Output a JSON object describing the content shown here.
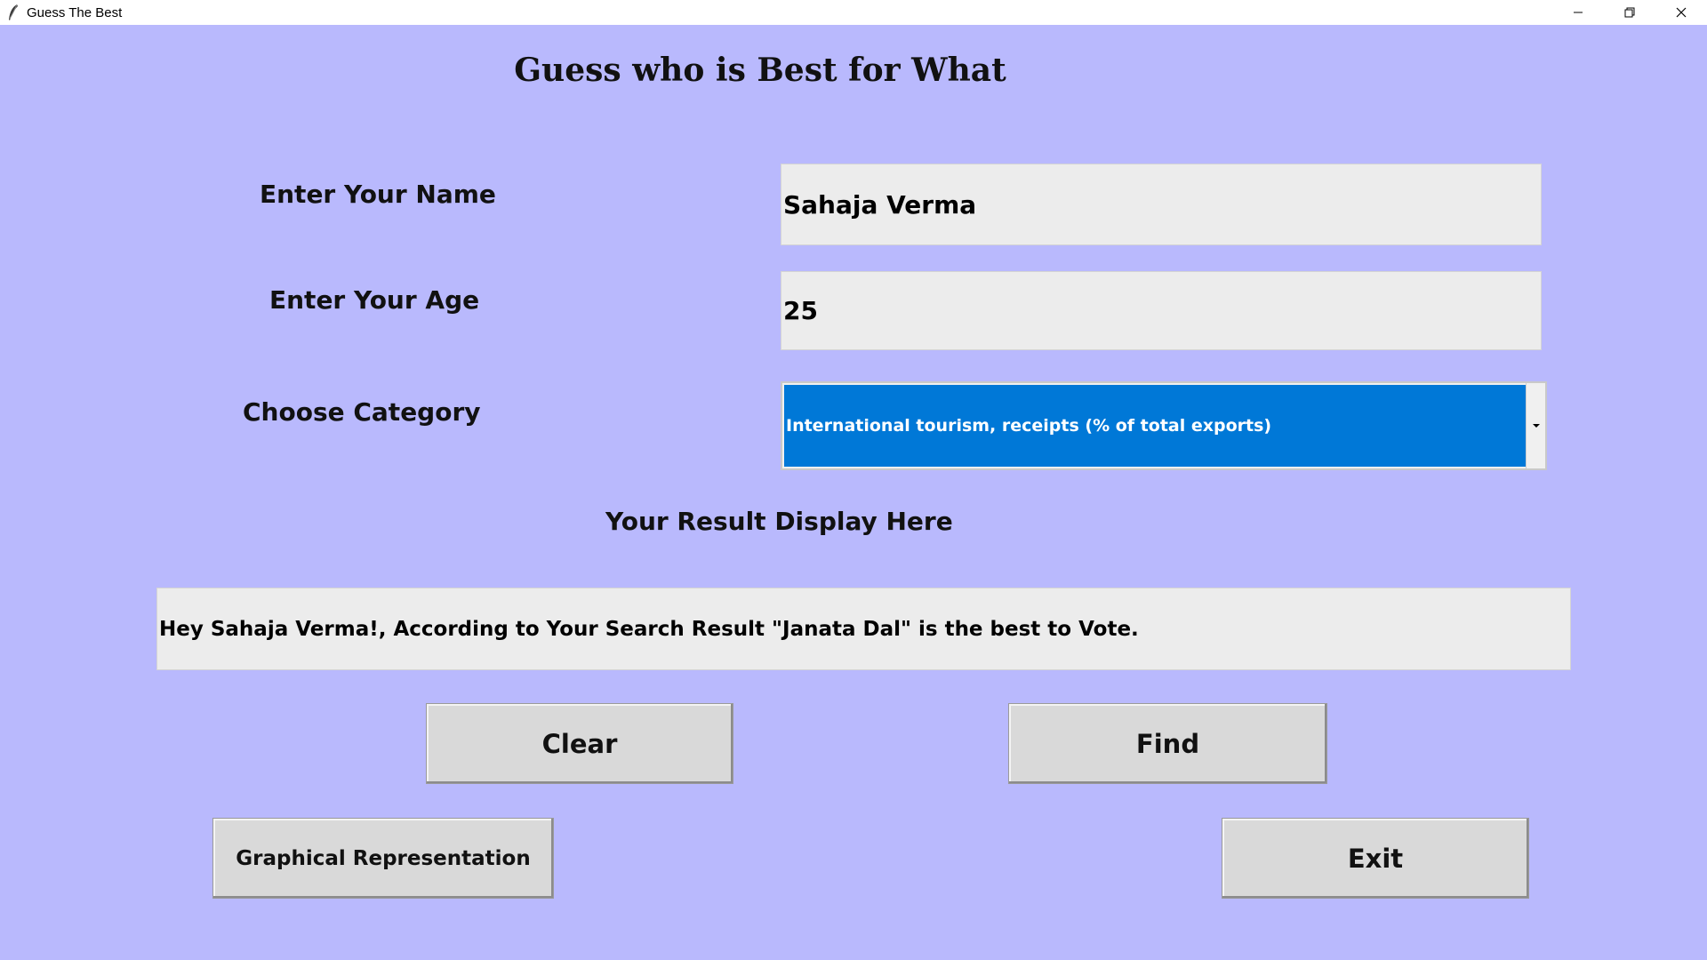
{
  "window": {
    "title": "Guess The Best",
    "controls": {
      "minimize_icon": "minimize-icon",
      "maximize_icon": "restore-icon",
      "close_icon": "close-icon"
    }
  },
  "form": {
    "heading": "Guess who is Best for What",
    "name_label": "Enter Your Name",
    "name_value": "Sahaja Verma",
    "age_label": "Enter Your Age",
    "age_value": "25",
    "category_label": "Choose Category",
    "category_selected": "International tourism, receipts (% of total exports)",
    "result_label": "Your Result Display Here",
    "result_value": "Hey Sahaja Verma!, According to Your Search Result \"Janata Dal\" is the best to Vote."
  },
  "buttons": {
    "clear": "Clear",
    "find": "Find",
    "graph": "Graphical Representation",
    "exit": "Exit"
  },
  "colors": {
    "background": "#b9b9fd",
    "entry_bg": "#ececec",
    "selection": "#0078d7",
    "button_bg": "#d9d9d9"
  }
}
